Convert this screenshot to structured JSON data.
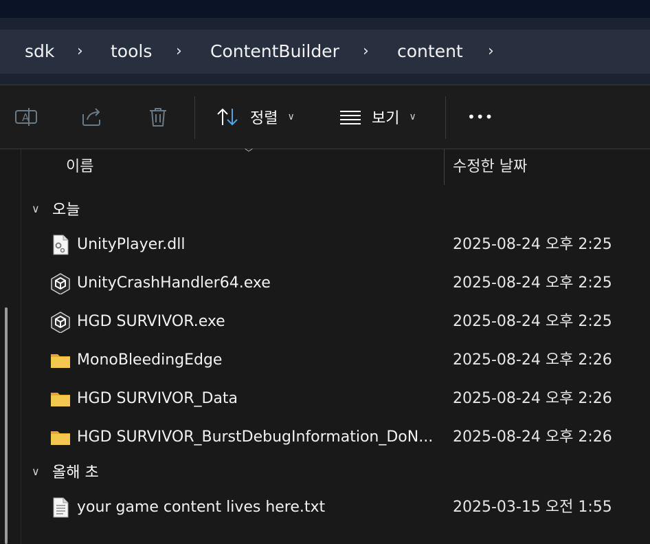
{
  "breadcrumb": [
    "sdk",
    "tools",
    "ContentBuilder",
    "content"
  ],
  "toolbar": {
    "sort_label": "정렬",
    "view_label": "보기",
    "more_label": "•••"
  },
  "columns": {
    "name": "이름",
    "date_modified": "수정한 날짜"
  },
  "groups": [
    {
      "label": "오늘",
      "files": [
        {
          "name": "UnityPlayer.dll",
          "date": "2025-08-24 오후 2:25",
          "icon": "dll-file-icon"
        },
        {
          "name": "UnityCrashHandler64.exe",
          "date": "2025-08-24 오후 2:25",
          "icon": "unity-exe-icon"
        },
        {
          "name": "HGD SURVIVOR.exe",
          "date": "2025-08-24 오후 2:25",
          "icon": "unity-exe-icon"
        },
        {
          "name": "MonoBleedingEdge",
          "date": "2025-08-24 오후 2:26",
          "icon": "folder-icon"
        },
        {
          "name": "HGD SURVIVOR_Data",
          "date": "2025-08-24 오후 2:26",
          "icon": "folder-icon"
        },
        {
          "name": "HGD SURVIVOR_BurstDebugInformation_DoN...",
          "date": "2025-08-24 오후 2:26",
          "icon": "folder-icon"
        }
      ]
    },
    {
      "label": "올해 초",
      "files": [
        {
          "name": "your game content lives here.txt",
          "date": "2025-03-15 오전 1:55",
          "icon": "text-file-icon"
        }
      ]
    }
  ],
  "colors": {
    "folder": "#f4c84d",
    "accent_blue": "#4aa8f0",
    "background": "#191919"
  }
}
